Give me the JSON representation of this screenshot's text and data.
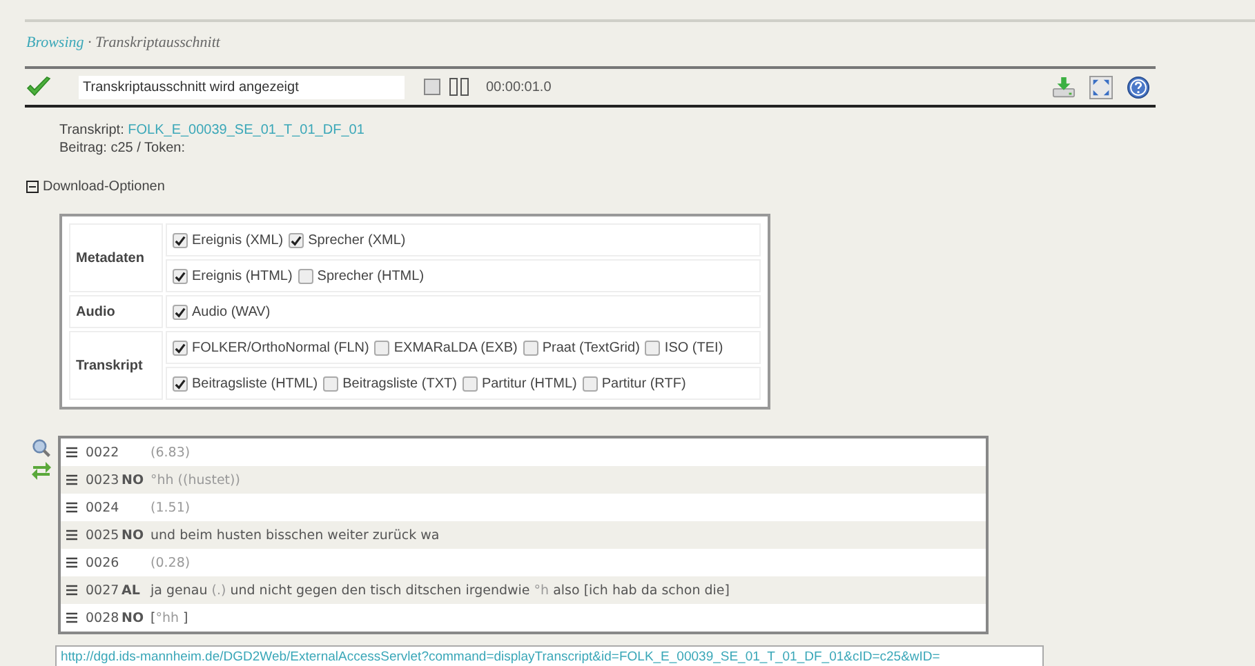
{
  "breadcrumb": {
    "link": "Browsing",
    "separator": " · ",
    "current": "Transkriptausschnitt"
  },
  "toolbar": {
    "status": "Transkriptausschnitt wird angezeigt",
    "time": "00:00:01.0"
  },
  "info": {
    "transcript_label": "Transkript: ",
    "transcript_id": "FOLK_E_00039_SE_01_T_01_DF_01",
    "contribution": "Beitrag: c25 / Token:"
  },
  "download_options": {
    "title": "Download-Optionen",
    "expanded": true,
    "groups": [
      {
        "label": "Metadaten",
        "rows": [
          [
            {
              "label": "Ereignis (XML)",
              "checked": true
            },
            {
              "label": "Sprecher (XML)",
              "checked": true
            }
          ],
          [
            {
              "label": "Ereignis (HTML)",
              "checked": true
            },
            {
              "label": "Sprecher (HTML)",
              "checked": false
            }
          ]
        ]
      },
      {
        "label": "Audio",
        "rows": [
          [
            {
              "label": "Audio (WAV)",
              "checked": true
            }
          ]
        ]
      },
      {
        "label": "Transkript",
        "rows": [
          [
            {
              "label": "FOLKER/OrthoNormal (FLN)",
              "checked": true
            },
            {
              "label": "EXMARaLDA (EXB)",
              "checked": false
            },
            {
              "label": "Praat (TextGrid)",
              "checked": false
            },
            {
              "label": "ISO (TEI)",
              "checked": false
            }
          ],
          [
            {
              "label": "Beitragsliste (HTML)",
              "checked": true
            },
            {
              "label": "Beitragsliste (TXT)",
              "checked": false
            },
            {
              "label": "Partitur (HTML)",
              "checked": false
            },
            {
              "label": "Partitur (RTF)",
              "checked": false
            }
          ]
        ]
      }
    ]
  },
  "transcript": [
    {
      "number": "0022",
      "parts": [
        {
          "text": "(6.83)",
          "muted": true
        }
      ]
    },
    {
      "number": "0023",
      "speaker": "NO",
      "parts": [
        {
          "text": "°hh ((hustet))",
          "muted": true
        }
      ]
    },
    {
      "number": "0024",
      "parts": [
        {
          "text": "(1.51)",
          "muted": true
        }
      ]
    },
    {
      "number": "0025",
      "speaker": "NO",
      "parts": [
        {
          "text": "und beim husten bisschen weiter zurück wa",
          "muted": false
        }
      ]
    },
    {
      "number": "0026",
      "parts": [
        {
          "text": "(0.28)",
          "muted": true
        }
      ]
    },
    {
      "number": "0027",
      "speaker": "AL",
      "parts": [
        {
          "text": "ja genau ",
          "muted": false
        },
        {
          "text": "(.)",
          "muted": true
        },
        {
          "text": " und nicht gegen den tisch ditschen irgendwie ",
          "muted": false
        },
        {
          "text": "°h",
          "muted": true
        },
        {
          "text": " also [ich hab da schon die]",
          "muted": false
        }
      ]
    },
    {
      "number": "0028",
      "speaker": "NO",
      "parts": [
        {
          "text": "[",
          "muted": false
        },
        {
          "text": "°hh",
          "muted": true
        },
        {
          "text": " ]",
          "muted": false
        }
      ]
    }
  ],
  "url": "http://dgd.ids-mannheim.de/DGD2Web/ExternalAccessServlet?command=displayTranscript&id=FOLK_E_00039_SE_01_T_01_DF_01&cID=c25&wID="
}
